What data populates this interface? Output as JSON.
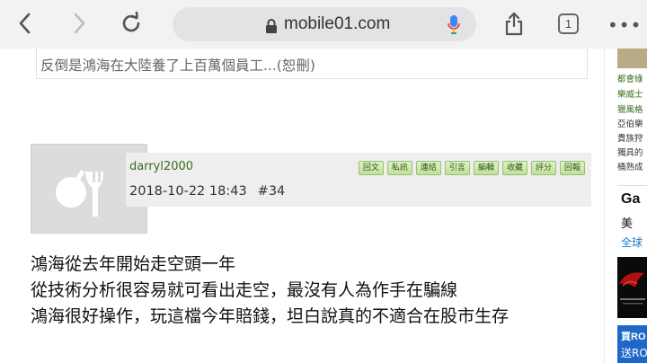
{
  "browser": {
    "url": "mobile01.com",
    "tab_count": "1",
    "more_glyph": "•••"
  },
  "quote": {
    "text": "反倒是鴻海在大陸養了上百萬個員工...(恕刪)"
  },
  "post": {
    "username": "darryl2000",
    "datetime": "2018-10-22 18:43",
    "post_number": "#34",
    "actions": [
      "回文",
      "私訊",
      "連結",
      "引言",
      "編輯",
      "收藏",
      "評分",
      "回報"
    ],
    "body": [
      "鴻海從去年開始走空頭一年",
      "從技術分析很容易就可看出走空，最沒有人為作手在騙線",
      "鴻海很好操作，玩這檔今年賠錢，坦白說真的不適合在股市生存"
    ]
  },
  "sidebar": {
    "items": [
      {
        "text": "都會綠",
        "style": "link"
      },
      {
        "text": "樂威士",
        "style": "link"
      },
      {
        "text": "獵風格",
        "style": "link"
      },
      {
        "text": "亞伯樂",
        "style": "plain"
      },
      {
        "text": "貴族狩",
        "style": "plain"
      },
      {
        "text": "獨具的",
        "style": "plain"
      },
      {
        "text": "桶熟成",
        "style": "plain"
      }
    ],
    "ad1": {
      "line1": "Ga",
      "line2": "美",
      "line3": "全球"
    },
    "ad2": {
      "line1": "買RO",
      "line2": "送RO"
    }
  },
  "colors": {
    "toolbar_bg": "#f2f2f2",
    "username": "#3a6d1a",
    "action_button_bg": "#cfe9b3",
    "ad_blue": "#1f68c9"
  }
}
